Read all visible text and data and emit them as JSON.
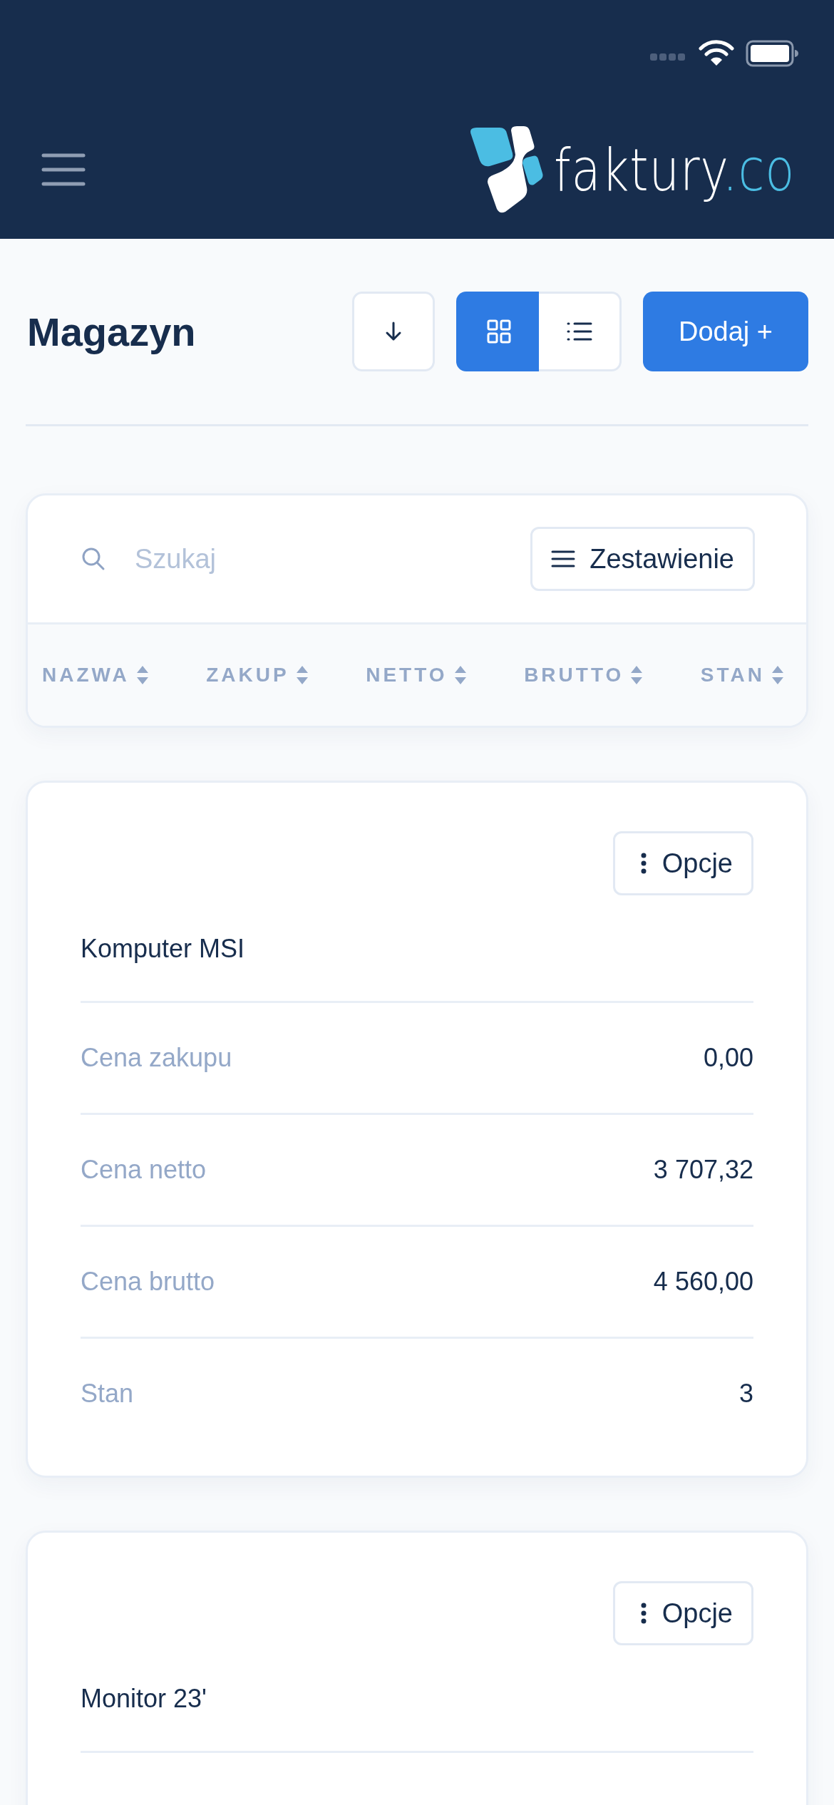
{
  "header": {
    "logo_text": "faktury",
    "logo_suffix": ".co"
  },
  "page": {
    "title": "Magazyn"
  },
  "view_toggle": [
    {
      "kind": "grid",
      "selected": true
    },
    {
      "kind": "list",
      "selected": false
    }
  ],
  "add_button": "Dodaj +",
  "search": {
    "placeholder": "Szukaj"
  },
  "summary_button": "Zestawienie",
  "columns": [
    "NAZWA",
    "ZAKUP",
    "NETTO",
    "BRUTTO",
    "STAN"
  ],
  "products": [
    {
      "name": "Komputer MSI",
      "options": "Opcje",
      "fields": [
        {
          "label": "Cena zakupu",
          "value": "0,00"
        },
        {
          "label": "Cena netto",
          "value": "3 707,32"
        },
        {
          "label": "Cena brutto",
          "value": "4 560,00"
        },
        {
          "label": "Stan",
          "value": "3"
        }
      ]
    },
    {
      "name": "Monitor 23'",
      "options": "Opcje"
    }
  ]
}
